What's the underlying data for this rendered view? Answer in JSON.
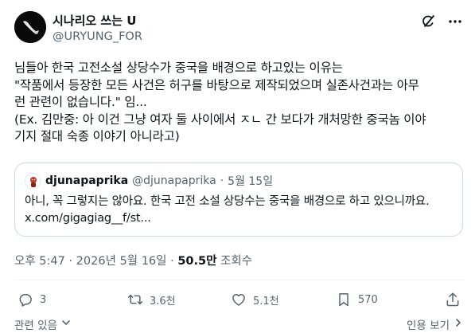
{
  "colors": {
    "text": "#0f1419",
    "secondary": "#536471",
    "border": "#cfd9de",
    "divider": "#eff3f4"
  },
  "author": {
    "name": "시나리오 쓰는 U",
    "handle": "@URYUNG_FOR"
  },
  "tweet": {
    "lines": [
      "님들아 한국 고전소설 상당수가 중국을 배경으로 하고있는 이유는",
      "\"작품에서 등장한 모든 사건은 허구를 바탕으로 제작되었으며 실존사건과는 아무",
      "런 관련이 없습니다.\" 임...",
      "(Ex. 김만중: 아 이건 그냥 여자 둘 사이에서 ㅈㄴ 간 보다가 개처망한 중국놈 이야",
      "기지 절대 숙종 이야기 아니라고)"
    ]
  },
  "quote": {
    "name": "djunapaprika",
    "handle": "@djunapaprika",
    "separator": "·",
    "date": "5월 15일",
    "lines": [
      "아니, 꼭 그렇지는 않아요. 한국 고전 소설 상당수는 중국을 배경으로 하고 있으니까요.",
      "x.com/gigagiag__f/st..."
    ]
  },
  "meta": {
    "time_date": "오후 5:47 · 2026년 5월 16일 · ",
    "views_count": "50.5만",
    "views_label": " 조회수"
  },
  "actions": {
    "replies": "3",
    "reposts": "3.6천",
    "likes": "5.1천",
    "bookmarks": "570"
  },
  "footer": {
    "related": "관련 있음",
    "quotes": "인용 보기"
  },
  "icons": {
    "grok": "grok-icon",
    "more": "more-icon",
    "reply": "reply-icon",
    "repost": "repost-icon",
    "like": "heart-icon",
    "bookmark": "bookmark-icon",
    "share": "share-icon"
  }
}
